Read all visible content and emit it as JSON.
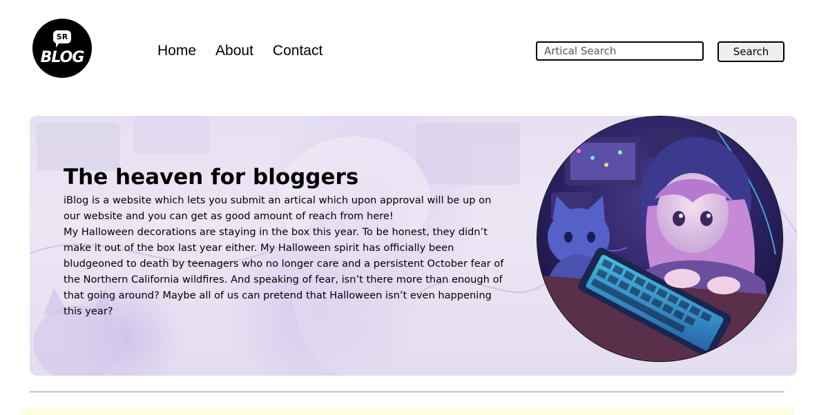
{
  "header": {
    "logo": {
      "bubble_text": "SR",
      "text": "BLOG"
    },
    "nav": [
      {
        "label": "Home"
      },
      {
        "label": "About"
      },
      {
        "label": "Contact"
      }
    ],
    "search": {
      "placeholder": "Artical Search",
      "button_label": "Search"
    }
  },
  "hero": {
    "title": "The heaven for bloggers",
    "paragraph_1": "iBlog is a website which lets you submit an artical which upon approval will be up on our website and you can get as good amount of reach from here!",
    "paragraph_2": "My Halloween decorations are staying in the box this year. To be honest, they didn’t make it out of the box last year either. My Halloween spirit has officially been bludgeoned to death by teenagers who no longer care and a persistent October fear of the Northern California wildfires. And speaking of fear, isn’t there more than enough of that going around? Maybe all of us can pretend that Halloween isn’t even happening this year?",
    "image_icon": "girl-with-cat-typing-image"
  },
  "colors": {
    "accent": "#000000",
    "hero_bg": "#e8e2f3",
    "footer_strip": "#fffde0"
  }
}
